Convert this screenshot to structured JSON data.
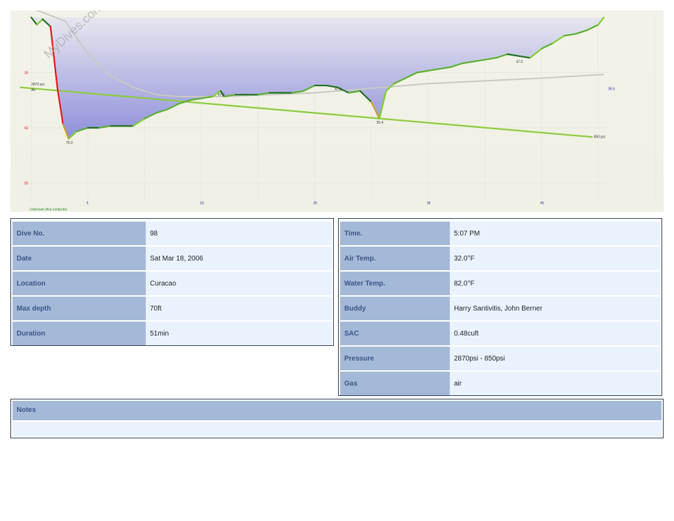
{
  "watermark": "MyDives.com",
  "chart_data": {
    "type": "line",
    "x": [
      0,
      0.5,
      1,
      1.7,
      2.3,
      2.8,
      3.3,
      4,
      5,
      6,
      7,
      8,
      9,
      10,
      11,
      12,
      13,
      14,
      15,
      16,
      16.7,
      17,
      18,
      19,
      20,
      21,
      22,
      23,
      24,
      25,
      26,
      27,
      28,
      29,
      30,
      30.7,
      31.3,
      32,
      33,
      34,
      35,
      36,
      37,
      38,
      39,
      40,
      41,
      42,
      43,
      44,
      45,
      46,
      47,
      48,
      49,
      50,
      50.5
    ],
    "depth": [
      0,
      4,
      1,
      5,
      38,
      58,
      66,
      62,
      60,
      60,
      59,
      59,
      59,
      55,
      52,
      50,
      47,
      45,
      44,
      43,
      40,
      43,
      42,
      42,
      42,
      41,
      41,
      41,
      40,
      37,
      37,
      38,
      41,
      40,
      46,
      55,
      40,
      36,
      33,
      30,
      29,
      28,
      27,
      25,
      24,
      23,
      22,
      20,
      21,
      22,
      17,
      14,
      10,
      9,
      7,
      4,
      0
    ],
    "depth_labels": [
      {
        "x": 3.3,
        "depth": 66,
        "text": "70.0"
      },
      {
        "x": 16.7,
        "depth": 40,
        "text": "47.0"
      },
      {
        "x": 27,
        "depth": 37,
        "text": "47.0"
      },
      {
        "x": 30.7,
        "depth": 55,
        "text": "55.4"
      },
      {
        "x": 43,
        "depth": 22,
        "text": "47.0"
      }
    ],
    "pressure_line": {
      "start": 2870,
      "end": 850,
      "start_label": "2870 psi",
      "start_sublabel": "Air",
      "end_label": "850 psi"
    },
    "reference_curve_end_label": "36.5",
    "y_ticks": [
      30,
      60,
      90
    ],
    "x_ticks": [
      5,
      15,
      25,
      35,
      45
    ],
    "xlim": [
      -2,
      56
    ],
    "ylim": [
      0,
      100
    ],
    "footer_label": "Unknown dive computer"
  },
  "left_table": [
    {
      "label": "Dive No.",
      "value": "98"
    },
    {
      "label": "Date",
      "value": "Sat Mar 18, 2006"
    },
    {
      "label": "Location",
      "value": "Curacao"
    },
    {
      "label": "Max depth",
      "value": "70ft"
    },
    {
      "label": "Duration",
      "value": "51min"
    }
  ],
  "right_table": [
    {
      "label": "Time.",
      "value": "5:07 PM"
    },
    {
      "label": "Air Temp.",
      "value": "32.0°F"
    },
    {
      "label": "Water Temp.",
      "value": "82.0°F"
    },
    {
      "label": "Buddy",
      "value": "Harry Santivitis, John Berner"
    },
    {
      "label": "SAC",
      "value": "0.48cuft"
    },
    {
      "label": "Pressure",
      "value": "2870psi - 850psi"
    },
    {
      "label": "Gas",
      "value": "air"
    }
  ],
  "notes": {
    "label": "Notes",
    "text": ""
  }
}
